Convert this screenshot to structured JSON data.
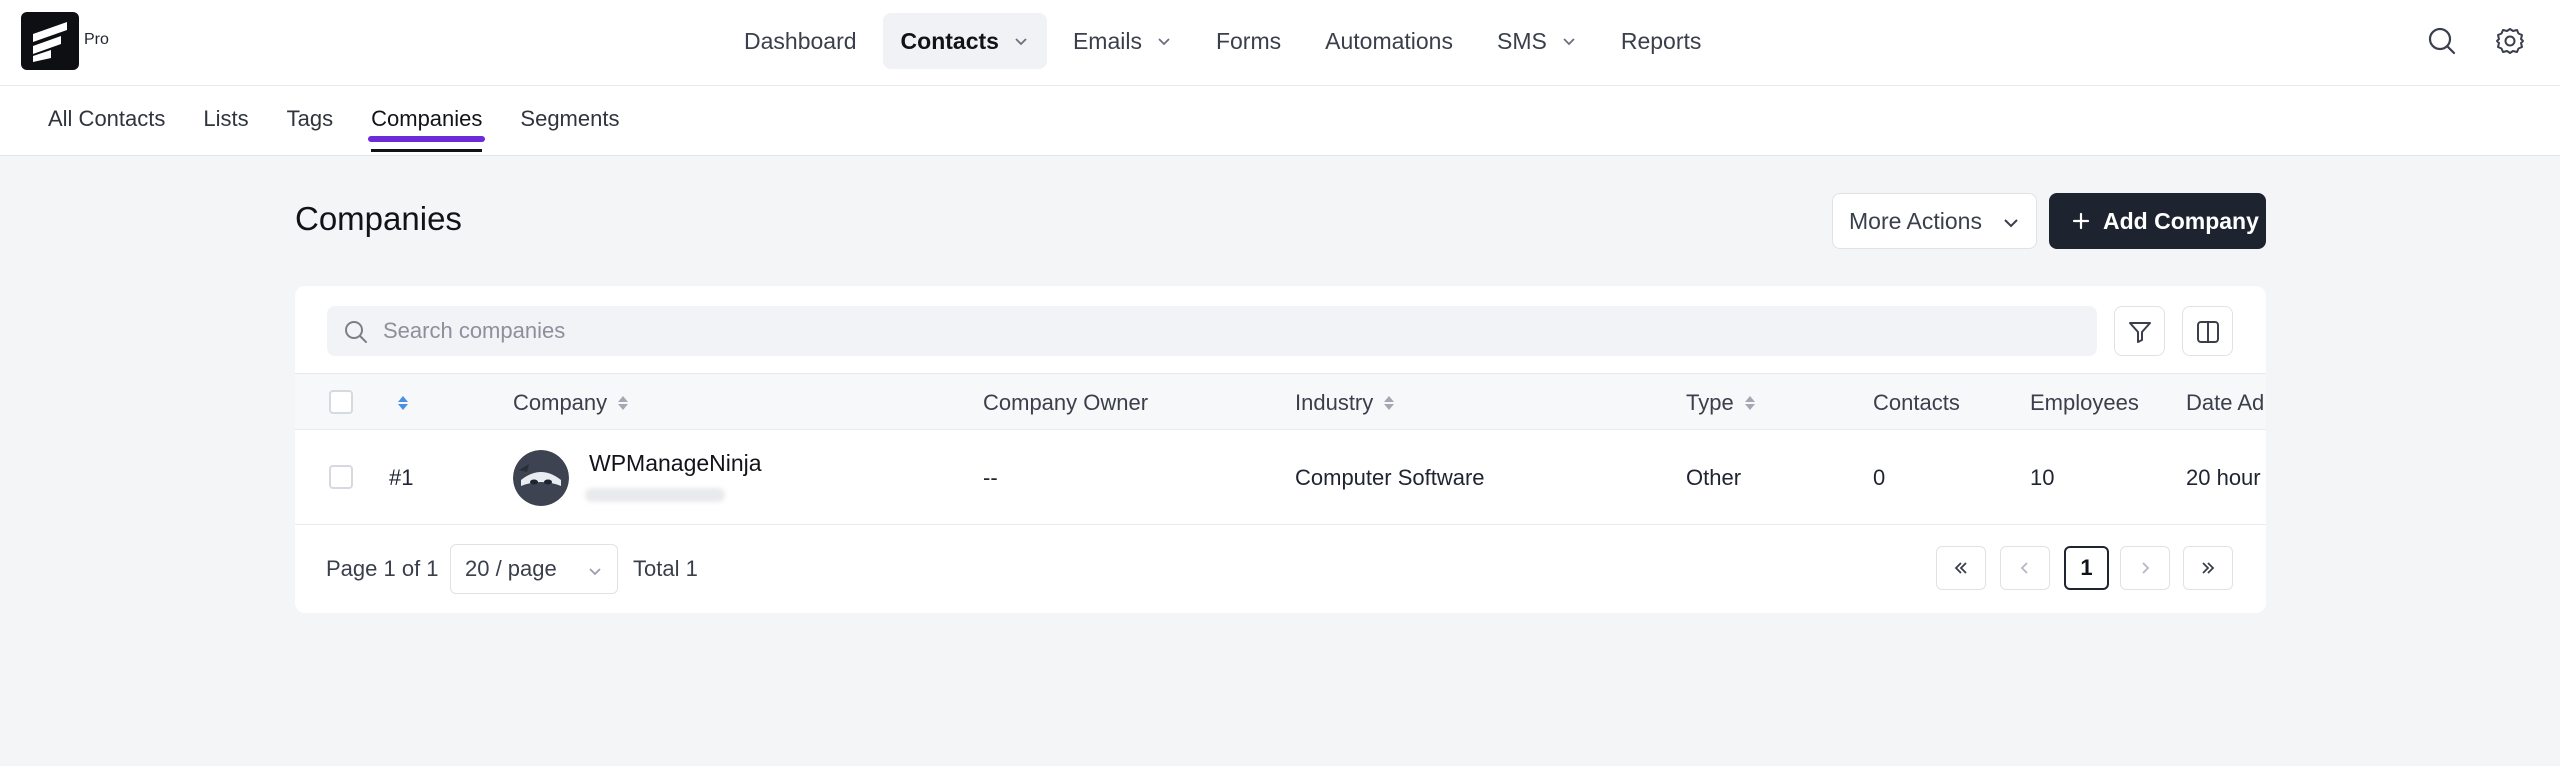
{
  "app": {
    "logo_label": "Pro"
  },
  "nav": [
    {
      "label": "Dashboard"
    },
    {
      "label": "Contacts"
    },
    {
      "label": "Emails"
    },
    {
      "label": "Forms"
    },
    {
      "label": "Automations"
    },
    {
      "label": "SMS"
    },
    {
      "label": "Reports"
    }
  ],
  "subnav": [
    {
      "label": "All Contacts"
    },
    {
      "label": "Lists"
    },
    {
      "label": "Tags"
    },
    {
      "label": "Companies"
    },
    {
      "label": "Segments"
    }
  ],
  "page": {
    "title": "Companies",
    "more_actions_label": "More Actions",
    "add_company_label": "Add Company"
  },
  "search": {
    "placeholder": "Search companies"
  },
  "table": {
    "columns": [
      "Company",
      "Company Owner",
      "Industry",
      "Type",
      "Contacts",
      "Employees",
      "Date Ad"
    ],
    "rows": [
      {
        "id": "#1",
        "company": "WPManageNinja",
        "owner": "--",
        "industry": "Computer Software",
        "type": "Other",
        "contacts": "0",
        "employees": "10",
        "date_added": "20 hour"
      }
    ]
  },
  "pagination": {
    "page_info": "Page 1 of 1",
    "per_page": "20 / page",
    "total": "Total 1",
    "current_page": "1"
  },
  "colors": {
    "accent": "#6b2bd9",
    "primary_button": "#1e2330",
    "sort_active": "#4a90e2"
  }
}
